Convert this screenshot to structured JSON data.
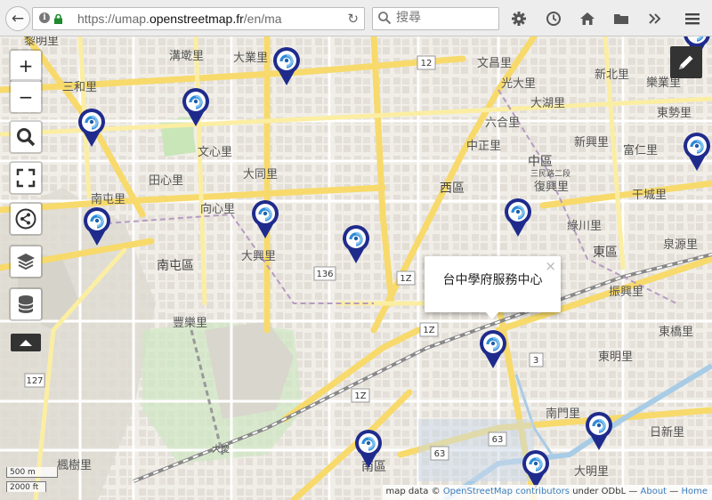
{
  "browser": {
    "url_prefix": "https://umap.",
    "url_domain": "openstreetmap.fr",
    "url_suffix": "/en/ma",
    "search_placeholder": "搜尋"
  },
  "map": {
    "zoom_in": "+",
    "zoom_out": "−",
    "popup_text": "台中學府服務中心",
    "popup_close": "×",
    "scale_metric": "500 m",
    "scale_imperial": "2000 ft",
    "attribution": {
      "prefix": "map data ©",
      "osm": "OpenStreetMap contributors",
      "license": "under ODbL —",
      "about": "About",
      "sep": "—",
      "home": "Home"
    },
    "route_badges": [
      "12",
      "136",
      "1Z",
      "1Z",
      "3",
      "1Z",
      "63",
      "63",
      "127"
    ],
    "district_labels": [
      "黎明里",
      "溝墘里",
      "大業里",
      "文昌里",
      "三和里",
      "新北里",
      "樂業里",
      "光大里",
      "東勢里",
      "大湖里",
      "六合里",
      "中正里",
      "新興里",
      "富仁里",
      "文心里",
      "中區",
      "三民路二段",
      "干城里",
      "田心里",
      "大同里",
      "西區",
      "復興里",
      "綠川里",
      "南屯里",
      "向心里",
      "東區",
      "泉源里",
      "大興里",
      "南屯區",
      "振興里",
      "豐樂里",
      "東橋里",
      "東明里",
      "南門里",
      "日新里",
      "楓樹里",
      "大慶",
      "南區",
      "大明里"
    ],
    "marker_icon": "service-center-marker-icon",
    "accent": "#1f2b8c"
  }
}
